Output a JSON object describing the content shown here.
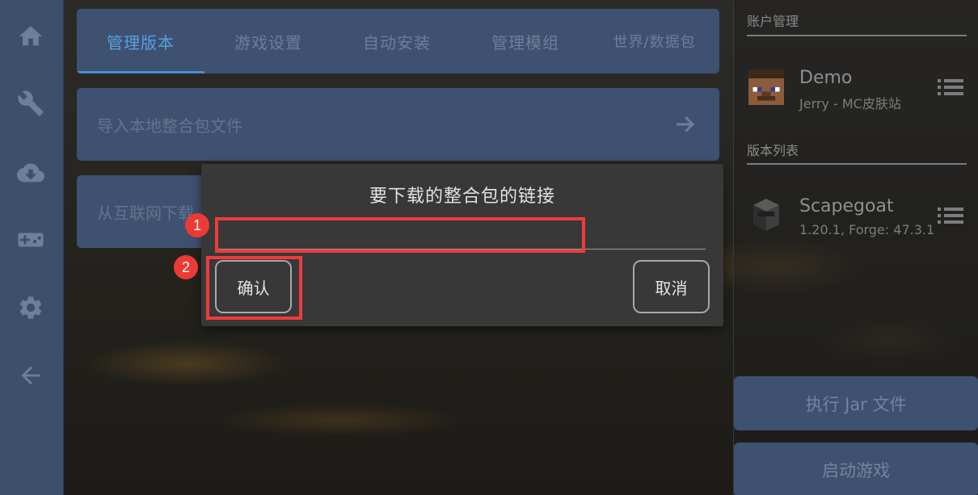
{
  "tabs": [
    {
      "label": "管理版本",
      "active": true
    },
    {
      "label": "游戏设置",
      "active": false
    },
    {
      "label": "自动安装",
      "active": false
    },
    {
      "label": "管理模组",
      "active": false
    },
    {
      "label": "世界/数据包",
      "active": false
    }
  ],
  "cards": {
    "import_local": "导入本地整合包文件",
    "from_internet": "从互联网下载"
  },
  "sidebar": {
    "icons": [
      "home-icon",
      "wrench-icon",
      "cloud-download-icon",
      "gamepad-icon",
      "settings-icon",
      "back-arrow-icon"
    ]
  },
  "right_panel": {
    "account_section": "账户管理",
    "account": {
      "name": "Demo",
      "subtitle": "Jerry - MC皮肤站"
    },
    "version_section": "版本列表",
    "version": {
      "name": "Scapegoat",
      "subtitle": "1.20.1, Forge: 47.3.1"
    },
    "run_jar": "执行 Jar 文件",
    "launch": "启动游戏"
  },
  "dialog": {
    "title": "要下载的整合包的链接",
    "input_value": "",
    "confirm": "确认",
    "cancel": "取消"
  },
  "annotations": [
    {
      "number": "1"
    },
    {
      "number": "2"
    }
  ],
  "colors": {
    "accent": "#56a0e0",
    "panel": "#3f5170",
    "highlight": "#ef3b3b"
  }
}
